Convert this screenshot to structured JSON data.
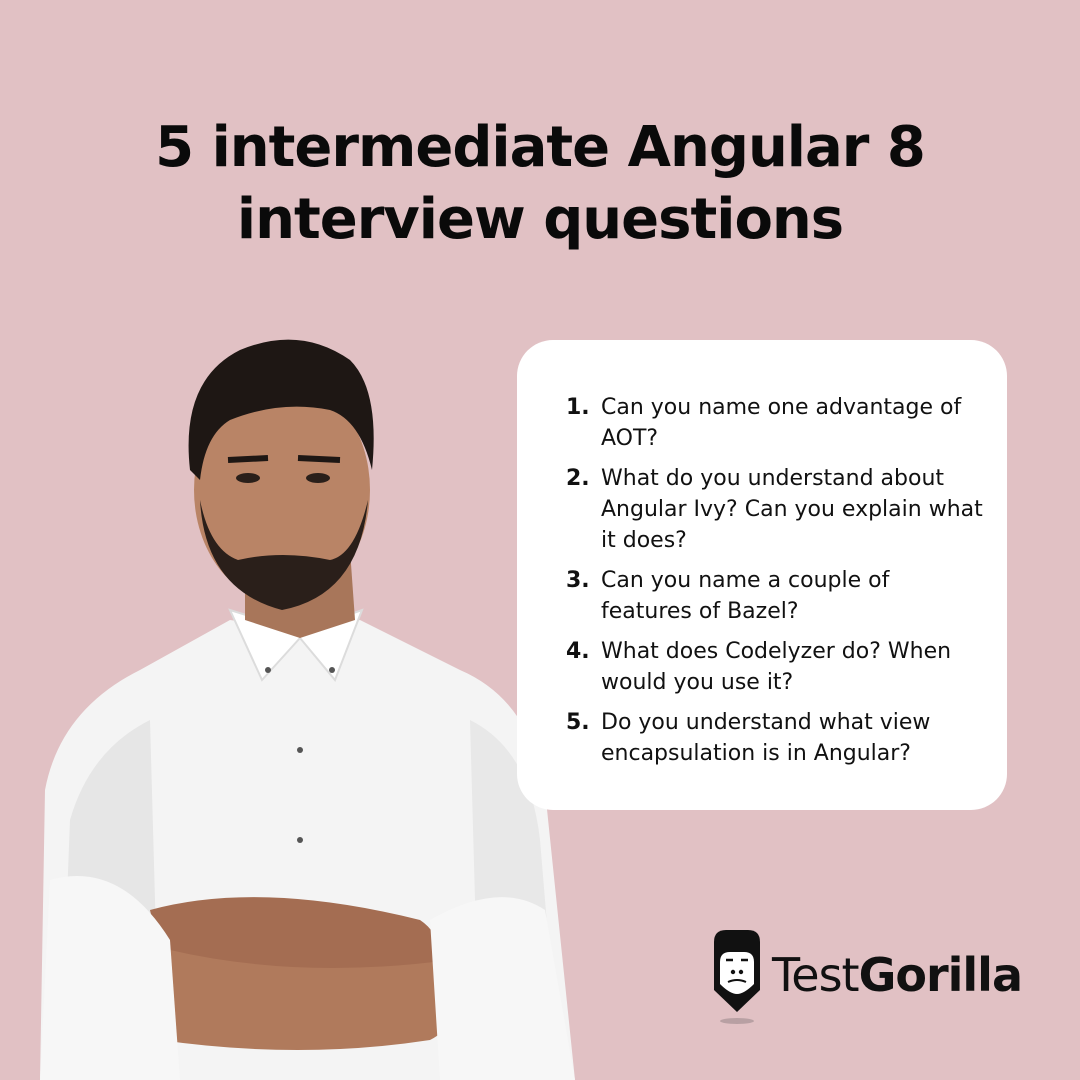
{
  "title": {
    "line1": "5 intermediate Angular 8",
    "line2": "interview questions"
  },
  "questions": [
    {
      "number": "1.",
      "text": "Can you name one advantage of AOT?"
    },
    {
      "number": "2.",
      "text": "What do you understand about Angular Ivy? Can you explain what it does?"
    },
    {
      "number": "3.",
      "text": "Can you name a couple of features of Bazel?"
    },
    {
      "number": "4.",
      "text": "What does Codelyzer do? When would you use it?"
    },
    {
      "number": "5.",
      "text": "Do you understand what view encapsulation is in Angular?"
    }
  ],
  "logo": {
    "icon": "gorilla-pencil-icon",
    "text_regular": "Test",
    "text_bold": "Gorilla"
  },
  "image": {
    "subject": "man-in-white-shirt-arms-crossed"
  },
  "colors": {
    "background": "#e1c1c4",
    "card": "#ffffff",
    "text": "#111111"
  }
}
